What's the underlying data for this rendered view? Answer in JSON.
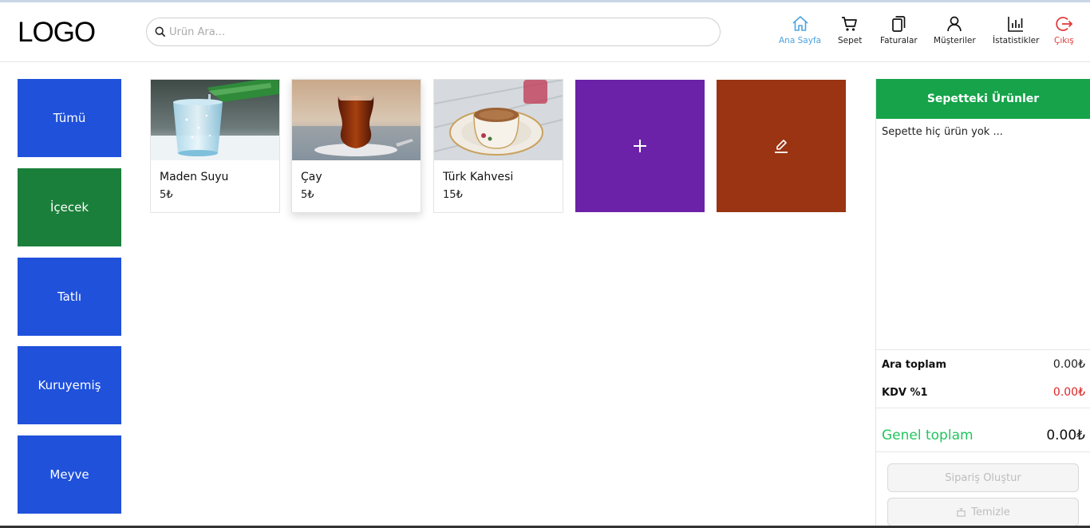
{
  "header": {
    "logo": "LOGO",
    "search_placeholder": "Ürün Ara...",
    "nav": [
      {
        "label": "Ana Sayfa",
        "icon": "home-icon"
      },
      {
        "label": "Sepet",
        "icon": "cart-icon"
      },
      {
        "label": "Faturalar",
        "icon": "copy-icon"
      },
      {
        "label": "Müşteriler",
        "icon": "user-icon"
      },
      {
        "label": "İstatistikler",
        "icon": "bar-chart-icon"
      },
      {
        "label": "Çıkış",
        "icon": "logout-icon"
      }
    ]
  },
  "categories": [
    {
      "label": "Tümü",
      "color": "#1f51db"
    },
    {
      "label": "İçecek",
      "color": "#1a7f3a"
    },
    {
      "label": "Tatlı",
      "color": "#1f51db"
    },
    {
      "label": "Kuruyemiş",
      "color": "#1f51db"
    },
    {
      "label": "Meyve",
      "color": "#1f51db"
    }
  ],
  "products": [
    {
      "name": "Maden Suyu",
      "price": "5₺"
    },
    {
      "name": "Çay",
      "price": "5₺"
    },
    {
      "name": "Türk Kahvesi",
      "price": "15₺"
    }
  ],
  "actions": {
    "add_icon": "plus-icon",
    "add_color": "#6b21a8",
    "edit_icon": "edit-icon",
    "edit_color": "#9a3412"
  },
  "cart": {
    "title": "Sepetteki Ürünler",
    "empty_text": "Sepette hiç ürün yok ...",
    "subtotal_label": "Ara toplam",
    "subtotal_value": "0.00₺",
    "tax_label": "KDV %1",
    "tax_value": "0.00₺",
    "total_label": "Genel toplam",
    "total_value": "0.00₺",
    "create_order_label": "Sipariş Oluştur",
    "clear_label": "Temizle"
  }
}
